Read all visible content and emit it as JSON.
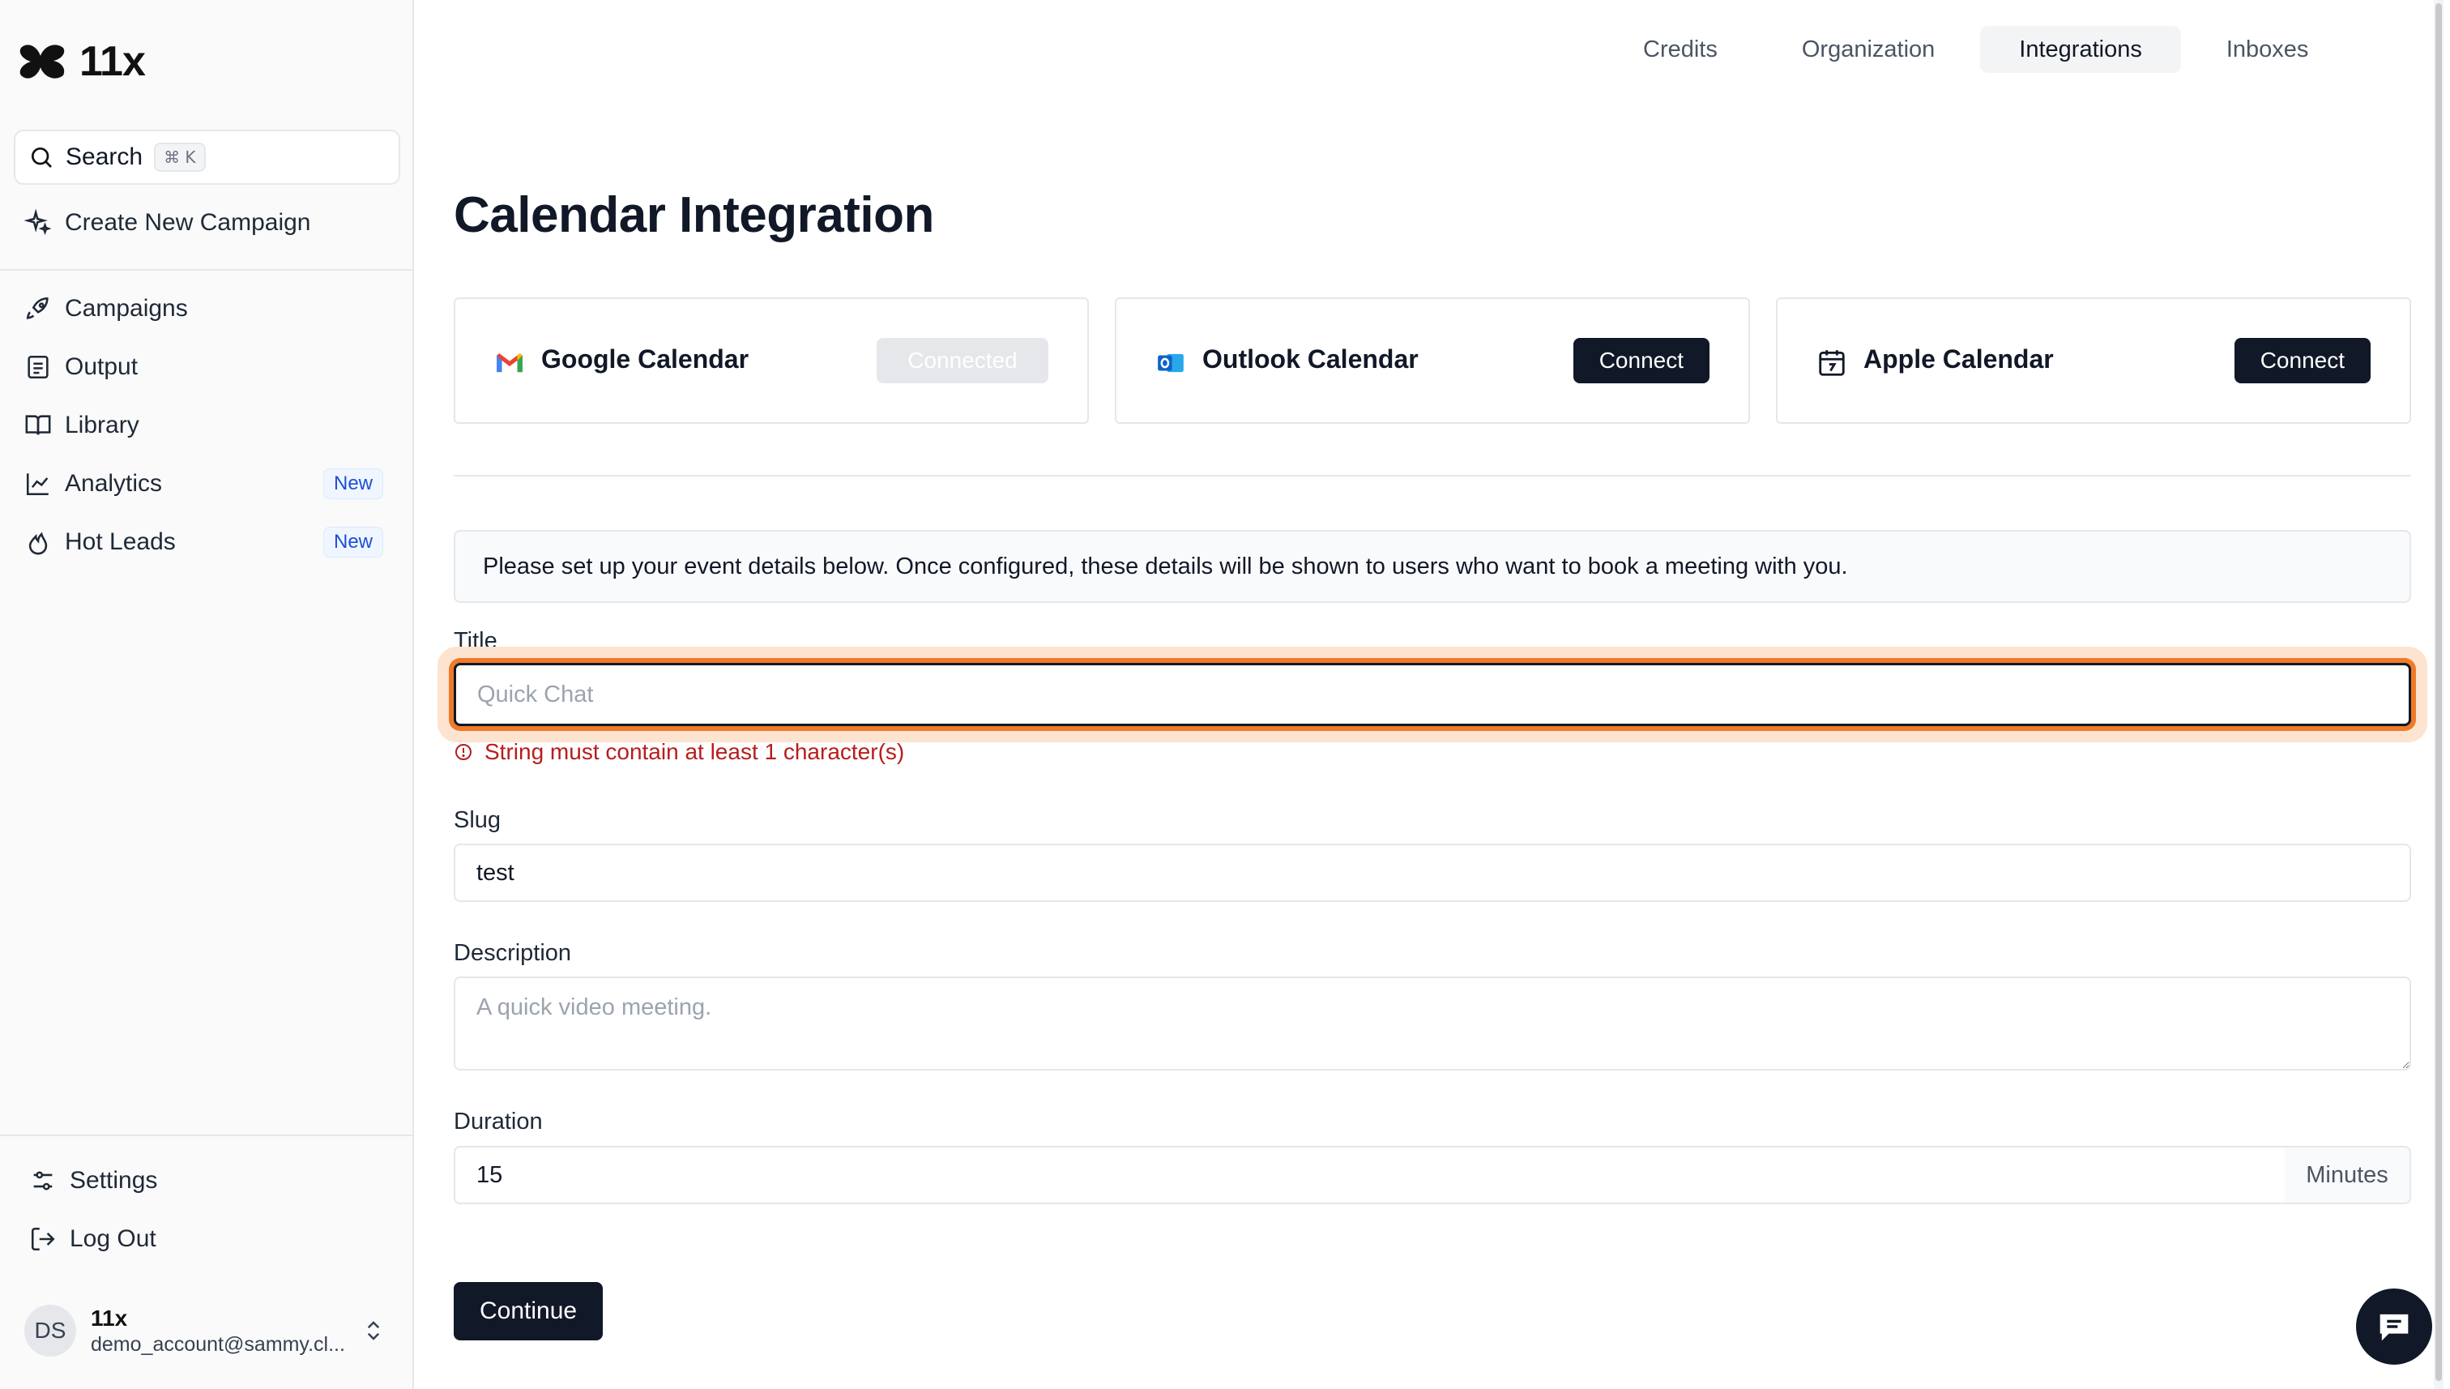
{
  "sidebar": {
    "logo_text": "11x",
    "search": {
      "label": "Search",
      "shortcut": "⌘ K"
    },
    "create_campaign": "Create New Campaign",
    "items": [
      {
        "label": "Campaigns",
        "icon": "rocket-icon"
      },
      {
        "label": "Output",
        "icon": "document-icon"
      },
      {
        "label": "Library",
        "icon": "book-icon"
      },
      {
        "label": "Analytics",
        "icon": "chart-icon",
        "badge": "New"
      },
      {
        "label": "Hot Leads",
        "icon": "flame-icon",
        "badge": "New"
      }
    ],
    "settings": "Settings",
    "logout": "Log Out",
    "user": {
      "initials": "DS",
      "name": "11x",
      "email": "demo_account@sammy.cl..."
    }
  },
  "tabs": [
    {
      "label": "Credits",
      "active": false
    },
    {
      "label": "Organization",
      "active": false
    },
    {
      "label": "Integrations",
      "active": true
    },
    {
      "label": "Inboxes",
      "active": false
    }
  ],
  "page": {
    "title": "Calendar Integration",
    "calendars": [
      {
        "name": "Google Calendar",
        "button": "Connected",
        "state": "disabled",
        "icon": "gmail-icon"
      },
      {
        "name": "Outlook Calendar",
        "button": "Connect",
        "state": "active",
        "icon": "outlook-icon"
      },
      {
        "name": "Apple Calendar",
        "button": "Connect",
        "state": "active",
        "icon": "calendar-icon"
      }
    ],
    "info": "Please set up your event details below. Once configured, these details will be shown to users who want to book a meeting with you.",
    "form": {
      "title": {
        "label": "Title",
        "value": "",
        "placeholder": "Quick Chat",
        "error": "String must contain at least 1 character(s)"
      },
      "slug": {
        "label": "Slug",
        "value": "test"
      },
      "description": {
        "label": "Description",
        "value": "",
        "placeholder": "A quick video meeting."
      },
      "duration": {
        "label": "Duration",
        "value": "15",
        "unit": "Minutes"
      },
      "submit": "Continue"
    }
  },
  "colors": {
    "primary": "#111827",
    "error": "#b91c1c",
    "focus_ring": "#ef7a29",
    "badge": "#1d4ed8"
  }
}
